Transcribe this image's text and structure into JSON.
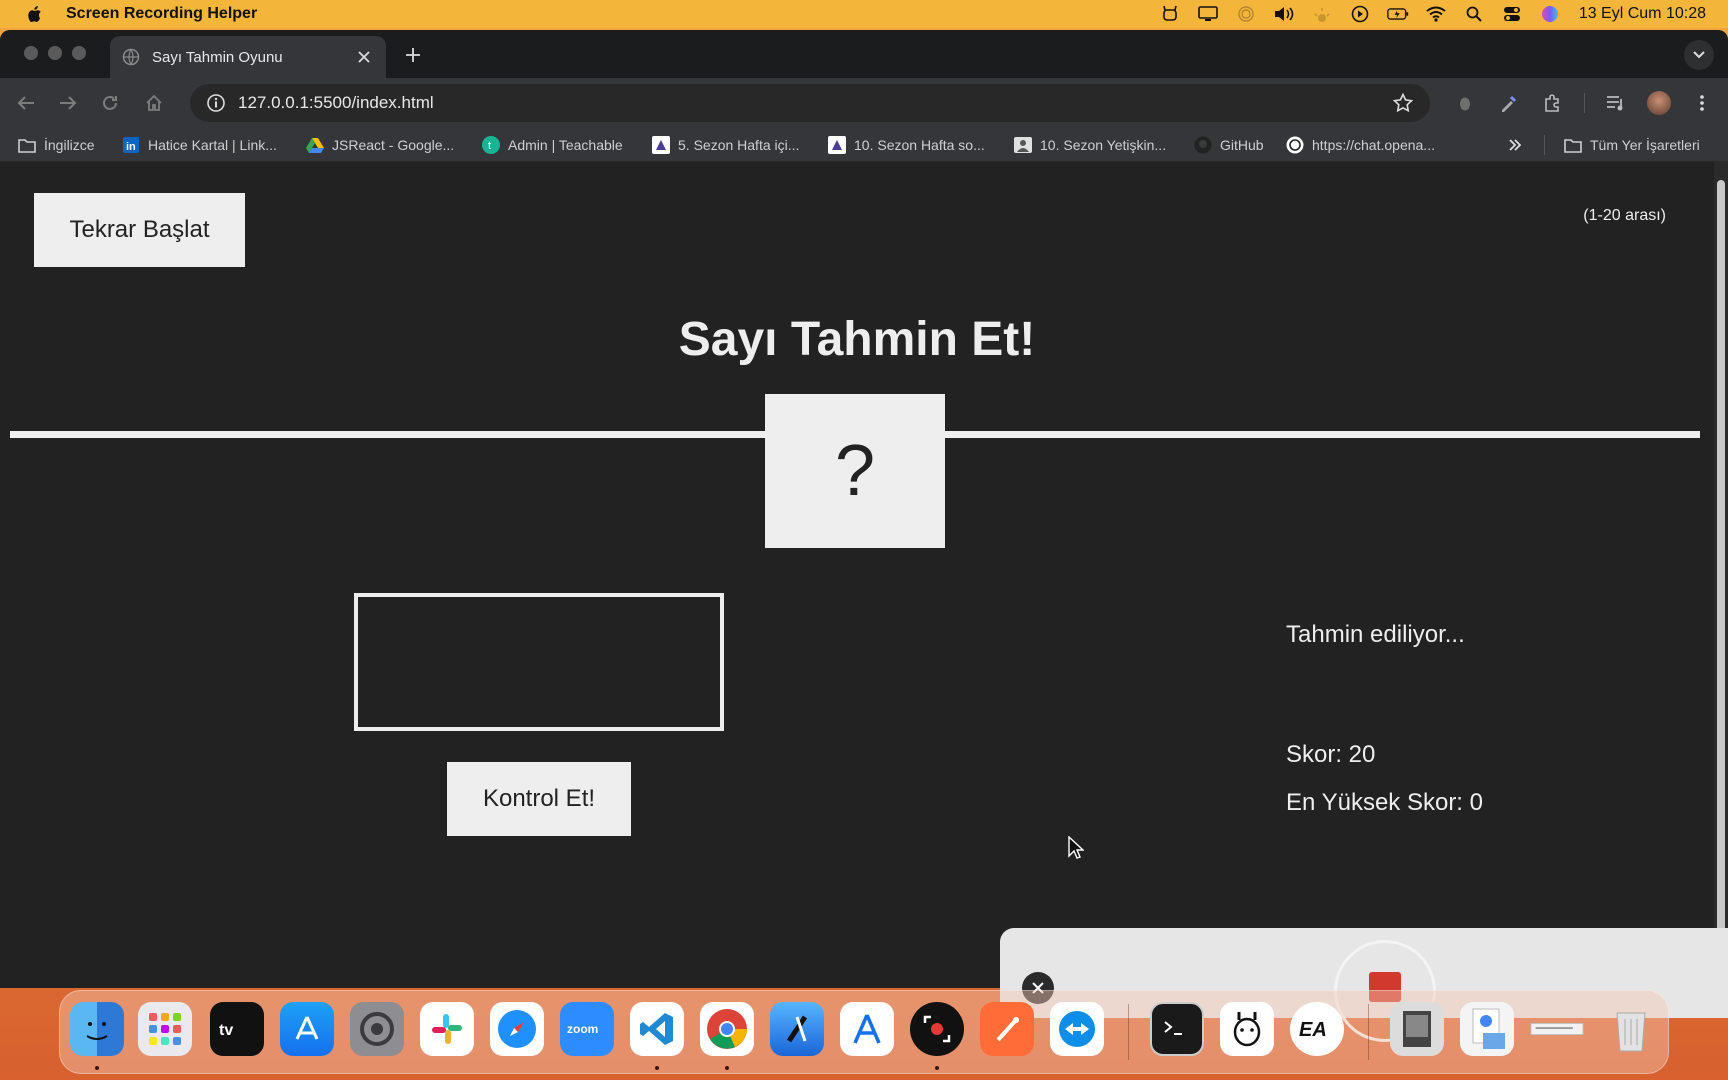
{
  "menubar": {
    "app_name": "Screen Recording Helper",
    "clock": "13 Eyl Cum  10:28"
  },
  "browser": {
    "tab_title": "Sayı Tahmin Oyunu",
    "url": "127.0.0.1:5500/index.html",
    "bookmarks": [
      "İngilizce",
      "Hatice Kartal | Link...",
      "JSReact - Google...",
      "Admin | Teachable",
      "5. Sezon Hafta içi...",
      "10. Sezon Hafta so...",
      "10. Sezon Yetişkin...",
      "GitHub",
      "https://chat.opena..."
    ],
    "all_bookmarks": "Tüm Yer İşaretleri"
  },
  "game": {
    "restart_label": "Tekrar Başlat",
    "range_hint": "(1-20 arası)",
    "title": "Sayı Tahmin Et!",
    "secret": "?",
    "guess_value": "",
    "check_label": "Kontrol Et!",
    "message": "Tahmin ediliyor...",
    "score_text": "Skor: 20",
    "highscore_text": "En Yüksek Skor: 0"
  },
  "colors": {
    "page_bg": "#222222",
    "light": "#eeeeee",
    "menubar": "#f4b63a"
  },
  "dock": {
    "apps": [
      "finder-icon",
      "launchpad-icon",
      "apple-tv-icon",
      "app-store-icon",
      "system-settings-icon",
      "slack-icon",
      "safari-icon",
      "zoom-icon",
      "vscode-icon",
      "chrome-icon",
      "xcode-icon",
      "instruments-icon",
      "screen-recorder-icon",
      "postman-icon",
      "teamviewer-icon",
      "terminal-icon",
      "ollama-icon",
      "ea-icon",
      "preview-icon",
      "downloads-stack-icon",
      "document-icon",
      "trash-icon"
    ]
  }
}
